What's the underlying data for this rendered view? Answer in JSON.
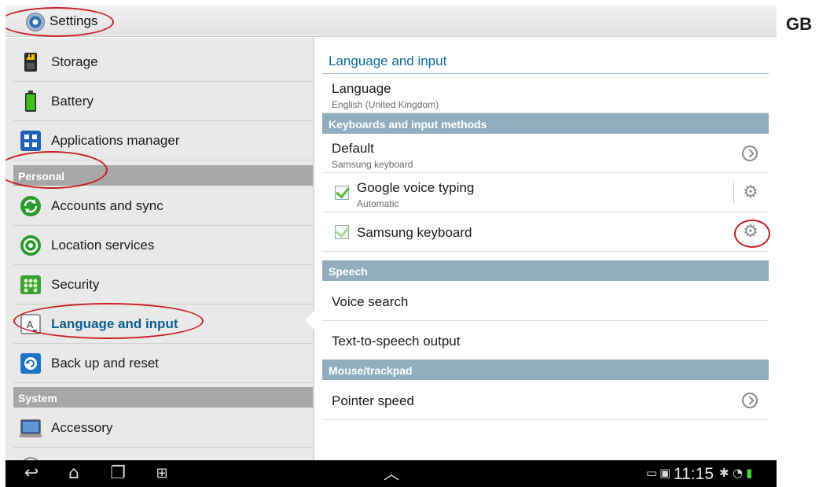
{
  "action_bar": {
    "title": "Settings",
    "icon": "settings-icon"
  },
  "corner_label": "GB",
  "sidebar": {
    "items_top": [
      {
        "label": "Storage",
        "icon": "storage-icon"
      },
      {
        "label": "Battery",
        "icon": "battery-icon"
      },
      {
        "label": "Applications manager",
        "icon": "apps-grid-icon"
      }
    ],
    "personal_header": "Personal",
    "personal_items": [
      {
        "label": "Accounts and sync",
        "icon": "sync-icon"
      },
      {
        "label": "Location services",
        "icon": "location-icon"
      },
      {
        "label": "Security",
        "icon": "security-icon"
      },
      {
        "label": "Language and input",
        "icon": "language-icon",
        "selected": true
      },
      {
        "label": "Back up and reset",
        "icon": "backup-icon"
      }
    ],
    "system_header": "System",
    "system_items": [
      {
        "label": "Accessory",
        "icon": "accessory-icon"
      }
    ]
  },
  "main": {
    "title": "Language and input",
    "language": {
      "title": "Language",
      "value": "English (United Kingdom)"
    },
    "keyboards_header": "Keyboards and input methods",
    "default": {
      "title": "Default",
      "value": "Samsung keyboard"
    },
    "google_voice": {
      "title": "Google voice typing",
      "value": "Automatic",
      "checked": true
    },
    "samsung_keyboard": {
      "title": "Samsung keyboard",
      "checked": true
    },
    "speech_header": "Speech",
    "voice_search": "Voice search",
    "tts": "Text-to-speech output",
    "mouse_header": "Mouse/trackpad",
    "pointer_speed": "Pointer speed"
  },
  "status_bar": {
    "time": "11:15"
  },
  "colors": {
    "accent_text": "#0b6aa0",
    "section_header": "#90aebf",
    "annotation": "#c81e23",
    "check": "#5bbd2b"
  }
}
